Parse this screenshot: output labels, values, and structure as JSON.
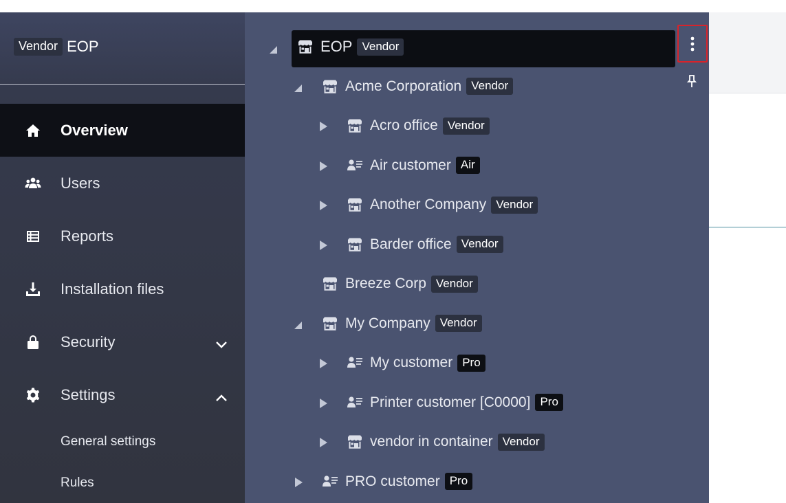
{
  "brand": {
    "badge": "Vendor",
    "name": "EOP"
  },
  "sidebar": {
    "items": [
      {
        "label": "Overview",
        "icon": "home-icon",
        "active": true
      },
      {
        "label": "Users",
        "icon": "users-icon"
      },
      {
        "label": "Reports",
        "icon": "reports-icon"
      },
      {
        "label": "Installation files",
        "icon": "download-icon"
      },
      {
        "label": "Security",
        "icon": "lock-icon",
        "chevron": "chevron-down-icon"
      },
      {
        "label": "Settings",
        "icon": "gear-icon",
        "chevron": "chevron-up-icon"
      }
    ],
    "sub_items": [
      {
        "label": "General settings"
      },
      {
        "label": "Rules"
      }
    ]
  },
  "tree": {
    "root": {
      "label": "EOP",
      "badge": "Vendor",
      "icon": "store-icon",
      "expanded": true
    },
    "nodes": [
      {
        "label": "Acme Corporation",
        "badge": "Vendor",
        "icon": "store-icon",
        "level": 1,
        "toggle": "expanded"
      },
      {
        "label": "Acro office",
        "badge": "Vendor",
        "icon": "store-icon",
        "level": 2,
        "toggle": "collapsed"
      },
      {
        "label": "Air customer",
        "badge": "Air",
        "icon": "customer-icon",
        "level": 2,
        "toggle": "collapsed"
      },
      {
        "label": "Another Company",
        "badge": "Vendor",
        "icon": "store-icon",
        "level": 2,
        "toggle": "collapsed"
      },
      {
        "label": "Barder office",
        "badge": "Vendor",
        "icon": "store-icon",
        "level": 2,
        "toggle": "collapsed"
      },
      {
        "label": "Breeze Corp",
        "badge": "Vendor",
        "icon": "store-icon",
        "level": 1,
        "toggle": "none"
      },
      {
        "label": "My Company",
        "badge": "Vendor",
        "icon": "store-icon",
        "level": 1,
        "toggle": "expanded"
      },
      {
        "label": "My customer",
        "badge": "Pro",
        "icon": "customer-icon",
        "level": 2,
        "toggle": "collapsed"
      },
      {
        "label": "Printer customer [C0000]",
        "badge": "Pro",
        "icon": "customer-icon",
        "level": 2,
        "toggle": "collapsed"
      },
      {
        "label": "vendor in container",
        "badge": "Vendor",
        "icon": "store-icon",
        "level": 2,
        "toggle": "collapsed"
      },
      {
        "label": "PRO customer",
        "badge": "Pro",
        "icon": "customer-icon",
        "level": 1,
        "toggle": "collapsed"
      }
    ],
    "actions": {
      "more_icon": "kebab-icon",
      "pin_icon": "pin-icon"
    }
  },
  "colors": {
    "sidebar_bg": "#31343f",
    "tree_bg": "#4a5370",
    "active_bg": "#0e1016",
    "highlight_border": "#d8232a"
  }
}
